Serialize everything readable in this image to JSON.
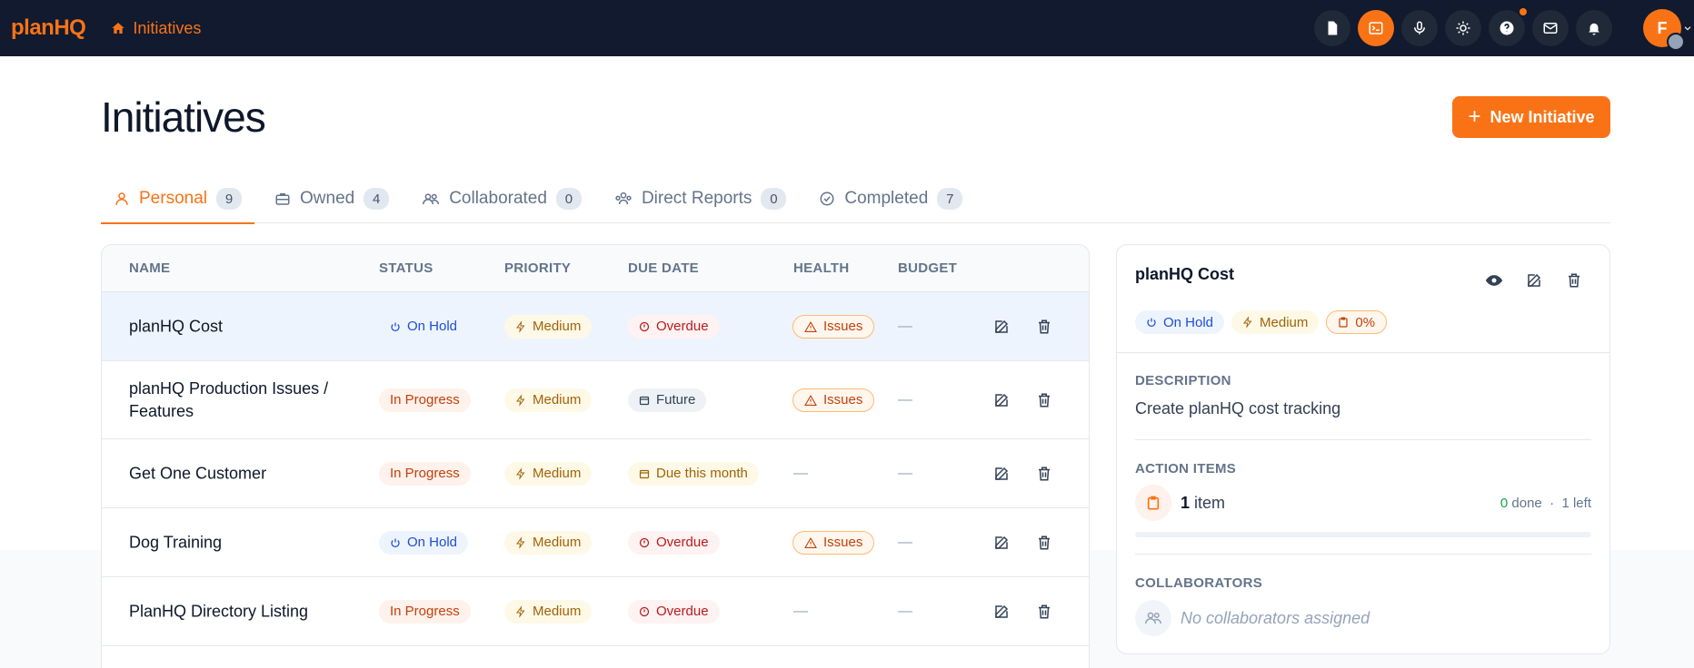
{
  "app": {
    "brand": "planHQ",
    "breadcrumb": "Initiatives"
  },
  "topbar": {
    "icons": [
      "document-icon",
      "terminal-icon",
      "microphone-icon",
      "sun-icon",
      "help-icon",
      "mail-icon",
      "bell-icon"
    ],
    "avatar_initial": "F"
  },
  "page": {
    "title": "Initiatives",
    "new_button": "New Initiative"
  },
  "tabs": [
    {
      "label": "Personal",
      "count": "9",
      "active": true
    },
    {
      "label": "Owned",
      "count": "4"
    },
    {
      "label": "Collaborated",
      "count": "0"
    },
    {
      "label": "Direct Reports",
      "count": "0"
    },
    {
      "label": "Completed",
      "count": "7"
    }
  ],
  "table": {
    "headers": {
      "name": "NAME",
      "status": "STATUS",
      "priority": "PRIORITY",
      "due": "DUE DATE",
      "health": "HEALTH",
      "budget": "BUDGET"
    },
    "rows": [
      {
        "name": "planHQ Cost",
        "status": "On Hold",
        "priority": "Medium",
        "due": "Overdue",
        "health": "Issues",
        "budget": "—"
      },
      {
        "name": "planHQ Production Issues / Features",
        "status": "In Progress",
        "priority": "Medium",
        "due": "Future",
        "health": "Issues",
        "budget": "—"
      },
      {
        "name": "Get One Customer",
        "status": "In Progress",
        "priority": "Medium",
        "due": "Due this month",
        "health": "—",
        "budget": "—"
      },
      {
        "name": "Dog Training",
        "status": "On Hold",
        "priority": "Medium",
        "due": "Overdue",
        "health": "Issues",
        "budget": "—"
      },
      {
        "name": "PlanHQ Directory Listing",
        "status": "In Progress",
        "priority": "Medium",
        "due": "Overdue",
        "health": "—",
        "budget": "—"
      }
    ]
  },
  "detail": {
    "title": "planHQ Cost",
    "status": "On Hold",
    "priority": "Medium",
    "budget_pct": "0%",
    "description_label": "DESCRIPTION",
    "description": "Create planHQ cost tracking",
    "action_items_label": "ACTION ITEMS",
    "items_count": "1",
    "items_word": "item",
    "done_count": "0",
    "done_word": "done",
    "left_text": "1 left",
    "collaborators_label": "COLLABORATORS",
    "no_collaborators": "No collaborators assigned"
  },
  "colors": {
    "accent": "#f97316",
    "topbar": "#111a2e"
  }
}
